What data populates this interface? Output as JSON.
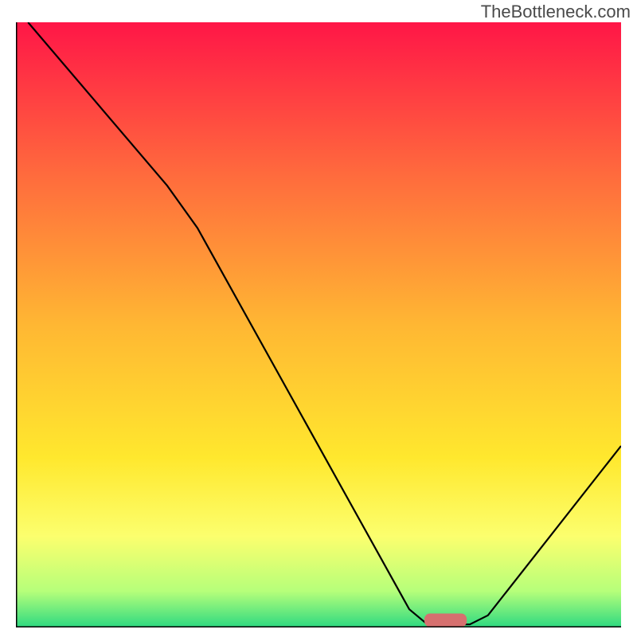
{
  "watermark": "TheBottleneck.com",
  "chart_data": {
    "type": "line",
    "title": "",
    "xlabel": "",
    "ylabel": "",
    "xlim": [
      0,
      100
    ],
    "ylim": [
      0,
      100
    ],
    "gradient": {
      "stops": [
        {
          "offset": 0,
          "color": "#ff1647"
        },
        {
          "offset": 0.25,
          "color": "#ff6a3d"
        },
        {
          "offset": 0.5,
          "color": "#ffb733"
        },
        {
          "offset": 0.72,
          "color": "#ffe82e"
        },
        {
          "offset": 0.85,
          "color": "#fcff6e"
        },
        {
          "offset": 0.94,
          "color": "#b6ff7a"
        },
        {
          "offset": 1.0,
          "color": "#2dd981"
        }
      ]
    },
    "curve": [
      {
        "x": 2,
        "y": 100
      },
      {
        "x": 25,
        "y": 73
      },
      {
        "x": 30,
        "y": 66
      },
      {
        "x": 65,
        "y": 3
      },
      {
        "x": 68,
        "y": 0.5
      },
      {
        "x": 75,
        "y": 0.5
      },
      {
        "x": 78,
        "y": 2
      },
      {
        "x": 100,
        "y": 30
      }
    ],
    "marker": {
      "x": 71,
      "y": 1.2,
      "width": 7,
      "height": 2.2,
      "color": "#d6706f"
    },
    "axes_color": "#000000"
  }
}
